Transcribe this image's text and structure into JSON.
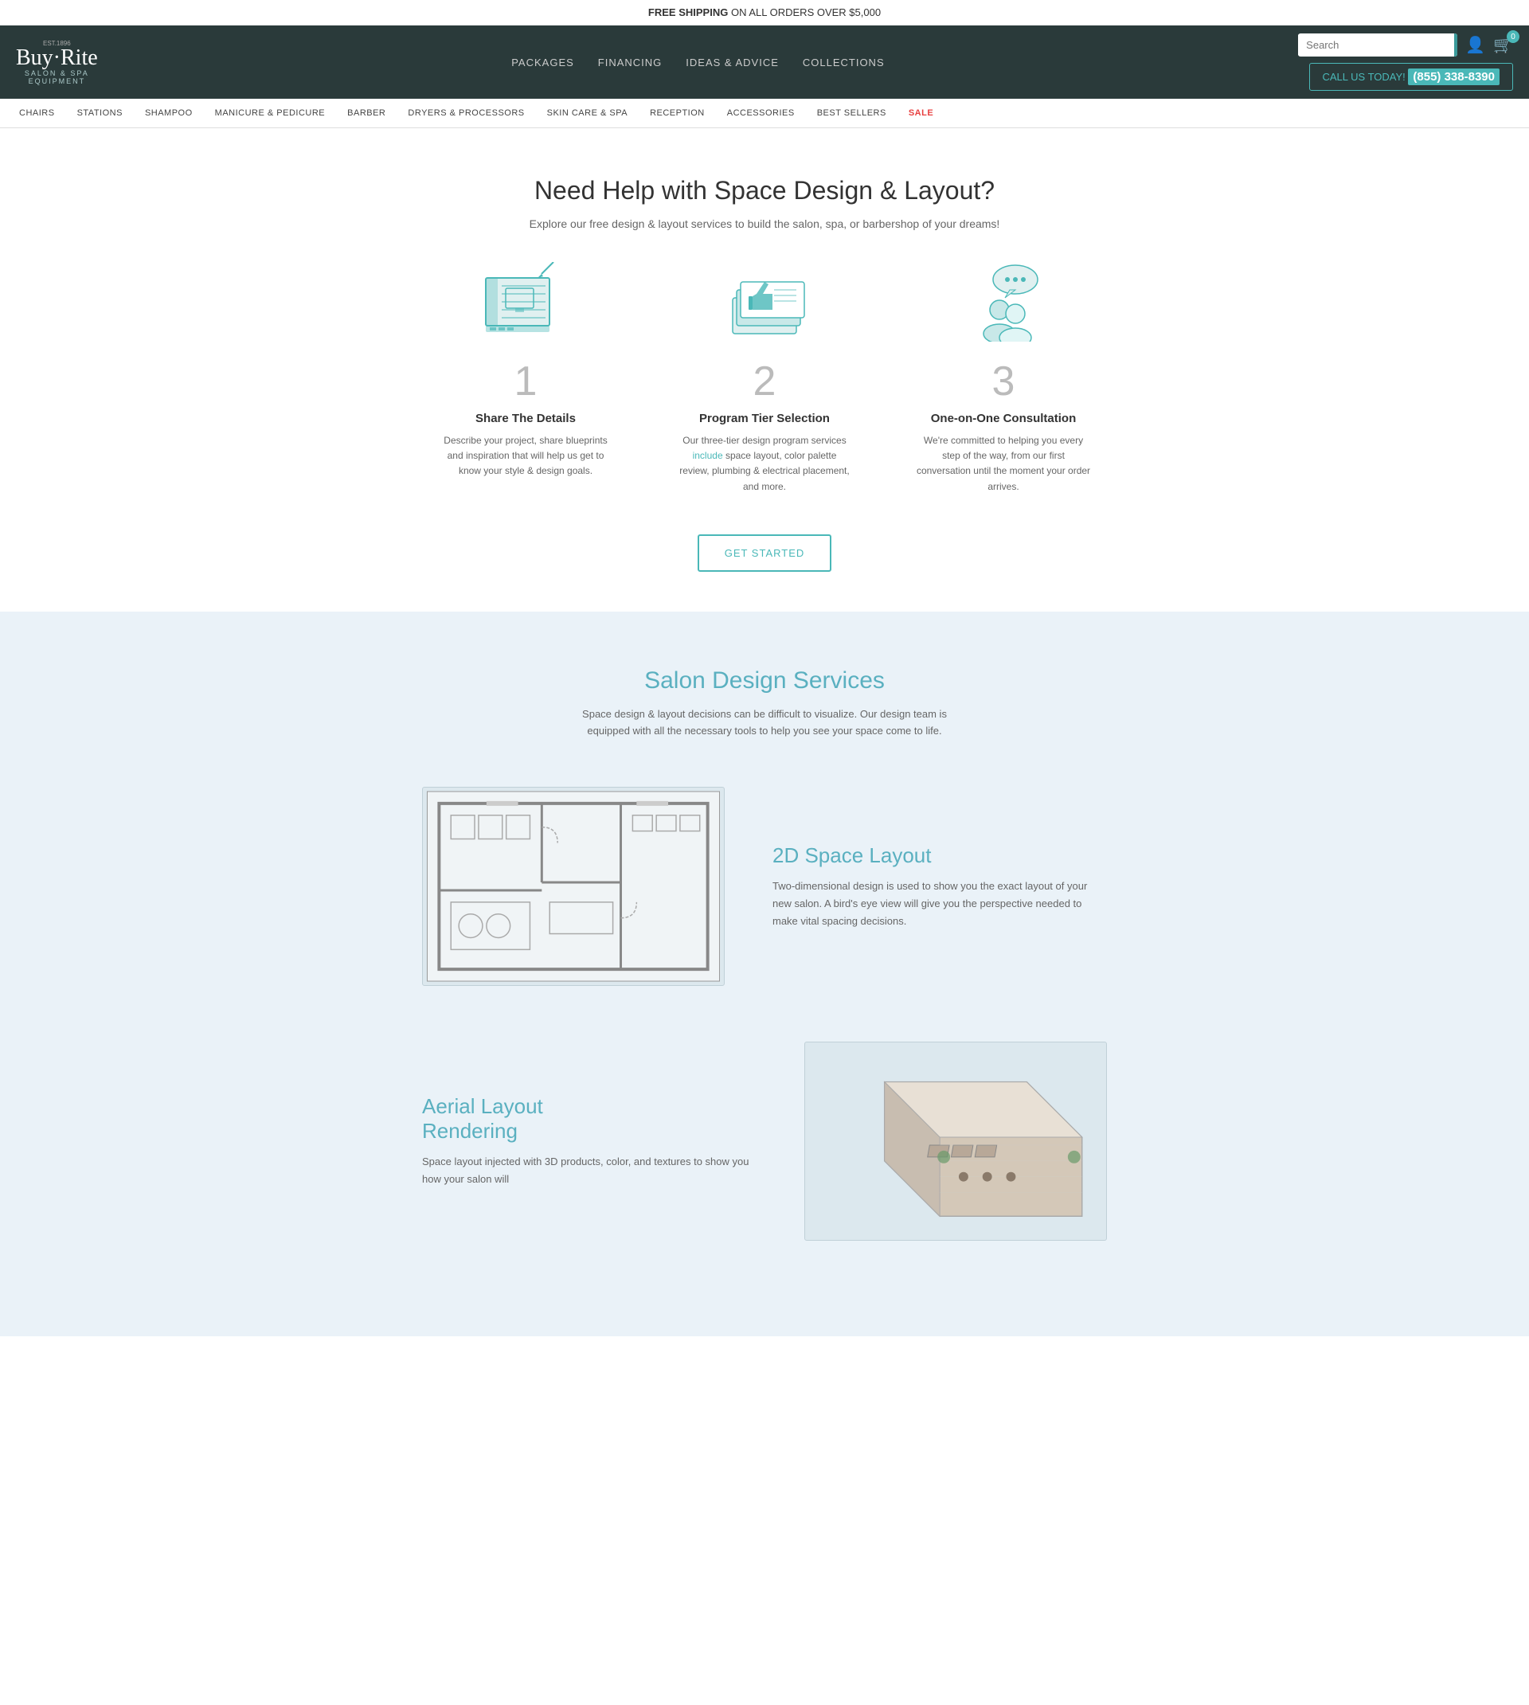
{
  "banner": {
    "text_bold": "FREE SHIPPING",
    "text_normal": "ON ALL ORDERS OVER $5,000"
  },
  "header": {
    "logo": {
      "est": "EST.1896",
      "name": "Buy·Rite",
      "sub": "SALON & SPA\nEQUIPMENT"
    },
    "nav": [
      {
        "label": "PACKAGES",
        "href": "#"
      },
      {
        "label": "FINANCING",
        "href": "#"
      },
      {
        "label": "IDEAS & ADVICE",
        "href": "#"
      },
      {
        "label": "COLLECTIONS",
        "href": "#"
      }
    ],
    "search": {
      "placeholder": "Search"
    },
    "cart": {
      "count": "0"
    },
    "call": {
      "prefix": "CALL US TODAY!",
      "number": "(855) 338-8390"
    }
  },
  "cat_nav": [
    {
      "label": "CHAIRS",
      "sale": false
    },
    {
      "label": "STATIONS",
      "sale": false
    },
    {
      "label": "SHAMPOO",
      "sale": false
    },
    {
      "label": "MANICURE & PEDICURE",
      "sale": false
    },
    {
      "label": "BARBER",
      "sale": false
    },
    {
      "label": "DRYERS & PROCESSORS",
      "sale": false
    },
    {
      "label": "SKIN CARE & SPA",
      "sale": false
    },
    {
      "label": "RECEPTION",
      "sale": false
    },
    {
      "label": "ACCESSORIES",
      "sale": false
    },
    {
      "label": "BEST SELLERS",
      "sale": false
    },
    {
      "label": "SALE",
      "sale": true
    }
  ],
  "hero": {
    "title": "Need Help with Space Design & Layout?",
    "subtitle": "Explore our free design & layout services to build the salon, spa, or barbershop of your dreams!",
    "steps": [
      {
        "number": "1",
        "title": "Share The Details",
        "description": "Describe your project, share blueprints and inspiration that will help us get to know your style & design goals."
      },
      {
        "number": "2",
        "title": "Program Tier Selection",
        "description": "Our three-tier design program services include space layout, color palette review, plumbing & electrical placement, and more.",
        "highlight_words": "include"
      },
      {
        "number": "3",
        "title": "One-on-One Consultation",
        "description": "We're committed to helping you every step of the way, from our first conversation until the moment your order arrives."
      }
    ],
    "cta": "GET STARTED"
  },
  "salon_design": {
    "title": "Salon Design Services",
    "description": "Space design & layout decisions can be difficult to visualize. Our design team is equipped with all the necessary tools to help you see your space come to life.",
    "items": [
      {
        "title": "2D Space Layout",
        "description": "Two-dimensional design is used to show you the exact layout of your new salon. A bird's eye view will give you the perspective needed to make vital spacing decisions.",
        "type": "2d"
      },
      {
        "title": "Aerial Layout\nRendering",
        "description": "Space layout injected with 3D products, color, and textures to show you how your salon will",
        "type": "aerial"
      }
    ]
  }
}
